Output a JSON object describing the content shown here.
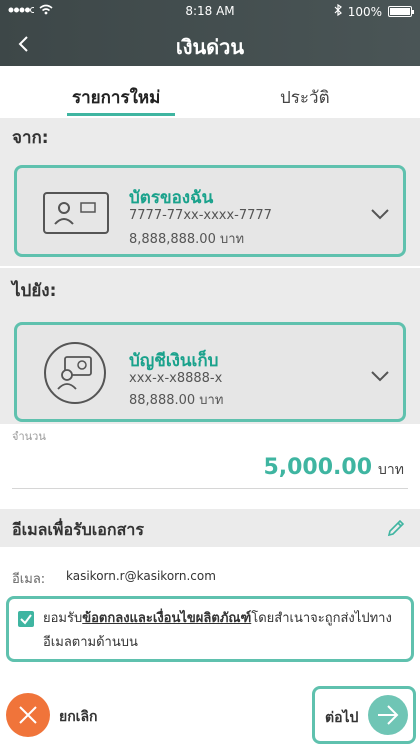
{
  "status": {
    "time": "8:18 AM",
    "battery": "100%"
  },
  "header": {
    "title": "เงินด่วน"
  },
  "tabs": [
    {
      "label": "รายการใหม่",
      "active": true
    },
    {
      "label": "ประวัติ",
      "active": false
    }
  ],
  "from": {
    "label": "จาก:",
    "account_name": "บัตรของฉัน",
    "account_number": "7777-77xx-xxxx-7777",
    "balance": "8,888,888.00 บาท"
  },
  "to": {
    "label": "ไปยัง:",
    "account_name": "บัญชีเงินเก็บ",
    "account_number": "xxx-x-x8888-x",
    "balance": "88,888.00 บาท"
  },
  "amount": {
    "label": "จำนวน",
    "value": "5,000.00",
    "unit": "บาท"
  },
  "email": {
    "section_title": "อีเมลเพื่อรับเอกสาร",
    "label": "อีเมล:",
    "value": "kasikorn.r@kasikorn.com"
  },
  "consent": {
    "prefix": "ยอมรับ",
    "link": "ข้อตกลงและเงื่อนไขผลิตภัณฑ์",
    "suffix": "โดยสำเนาจะถูกส่งไปทางอีเมลตามด้านบน",
    "checked": true
  },
  "footer": {
    "cancel_label": "ยกเลิก",
    "next_label": "ต่อไป"
  },
  "colors": {
    "accent": "#3fb5a1",
    "highlight": "#5fc1ae",
    "cancel": "#f0743a",
    "header": "#3d4748"
  }
}
